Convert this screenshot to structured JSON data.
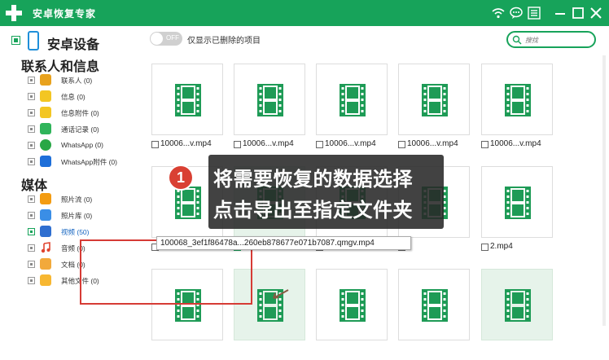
{
  "titlebar": {
    "app_title": "安卓恢复专家"
  },
  "sidebar": {
    "device_label": "安卓设备",
    "groups": [
      {
        "title": "联系人和信息",
        "items": [
          {
            "label": "联系人 (0)",
            "color": "#e8a21e"
          },
          {
            "label": "信息 (0)",
            "color": "#f3c623"
          },
          {
            "label": "信息附件 (0)",
            "color": "#f3c623"
          },
          {
            "label": "通话记录 (0)",
            "color": "#2fb45a"
          },
          {
            "label": "WhatsApp (0)",
            "color": "#28a745"
          },
          {
            "label": "WhatsApp附件 (0)",
            "color": "#1e6fd9"
          }
        ]
      },
      {
        "title": "媒体",
        "items": [
          {
            "label": "照片流 (0)",
            "color": "#f39c12"
          },
          {
            "label": "照片库 (0)",
            "color": "#3a8ee6"
          },
          {
            "label": "视频 (50)",
            "color": "#2f6fd0"
          },
          {
            "label": "音频 (0)",
            "color": "#e0442f"
          },
          {
            "label": "文档 (0)",
            "color": "#f2a93b"
          },
          {
            "label": "其他文件 (0)",
            "color": "#f7b731"
          }
        ]
      }
    ]
  },
  "main": {
    "toggle_text": "OFF",
    "filter_label": "仅显示已删除的项目",
    "search_placeholder": "搜找",
    "files": [
      {
        "name": "10006...v.mp4",
        "checked": false,
        "selected": false
      },
      {
        "name": "10006...v.mp4",
        "checked": false,
        "selected": false
      },
      {
        "name": "10006...v.mp4",
        "checked": false,
        "selected": false
      },
      {
        "name": "10006...v.mp4",
        "checked": false,
        "selected": false
      },
      {
        "name": "10006...v.mp4",
        "checked": false,
        "selected": false
      },
      {
        "name": "10006...v.mp4",
        "checked": false,
        "selected": false
      },
      {
        "name": "10006...v.mp4",
        "checked": true,
        "selected": true
      },
      {
        "name": "10006...v.mp4",
        "checked": false,
        "selected": false
      },
      {
        "name": "",
        "checked": false,
        "selected": false
      },
      {
        "name": "2.mp4",
        "checked": false,
        "selected": false
      },
      {
        "name": "",
        "checked": false,
        "selected": false
      },
      {
        "name": "",
        "checked": false,
        "selected": true
      },
      {
        "name": "",
        "checked": false,
        "selected": false
      },
      {
        "name": "",
        "checked": false,
        "selected": false
      },
      {
        "name": "",
        "checked": false,
        "selected": true
      }
    ],
    "tooltip": "100068_3ef1f86478a...260eb878677e071b7087.qmgv.mp4"
  },
  "overlay": {
    "badge": "1",
    "line1": "将需要恢复的数据选择",
    "line2": "点击导出至指定文件夹"
  },
  "colors": {
    "accent": "#17a35a",
    "highlight": "#d63b35"
  }
}
